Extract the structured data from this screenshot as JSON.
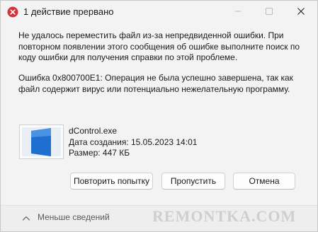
{
  "window": {
    "title": "1 действие прервано"
  },
  "message": {
    "paragraph1": "Не удалось переместить файл из-за непредвиденной ошибки. При повторном появлении этого сообщения об ошибке выполните поиск по коду ошибки для получения справки по этой проблеме.",
    "paragraph2": "Ошибка 0x800700E1: Операция не была успешно завершена, так как файл содержит вирус или потенциально нежелательную программу."
  },
  "file": {
    "name": "dControl.exe",
    "created": "Дата создания: 15.05.2023 14:01",
    "size": "Размер: 447 КБ",
    "icon": "file-thumbnail-icon"
  },
  "buttons": {
    "retry": "Повторить попытку",
    "skip": "Пропустить",
    "cancel": "Отмена"
  },
  "footer": {
    "fewer_details": "Меньше сведений"
  },
  "watermark": "REMONTKA.COM",
  "colors": {
    "window_bg": "#f3f3f3",
    "footer_bg": "#eeeeee",
    "icon_blue": "#1e6fd0"
  }
}
